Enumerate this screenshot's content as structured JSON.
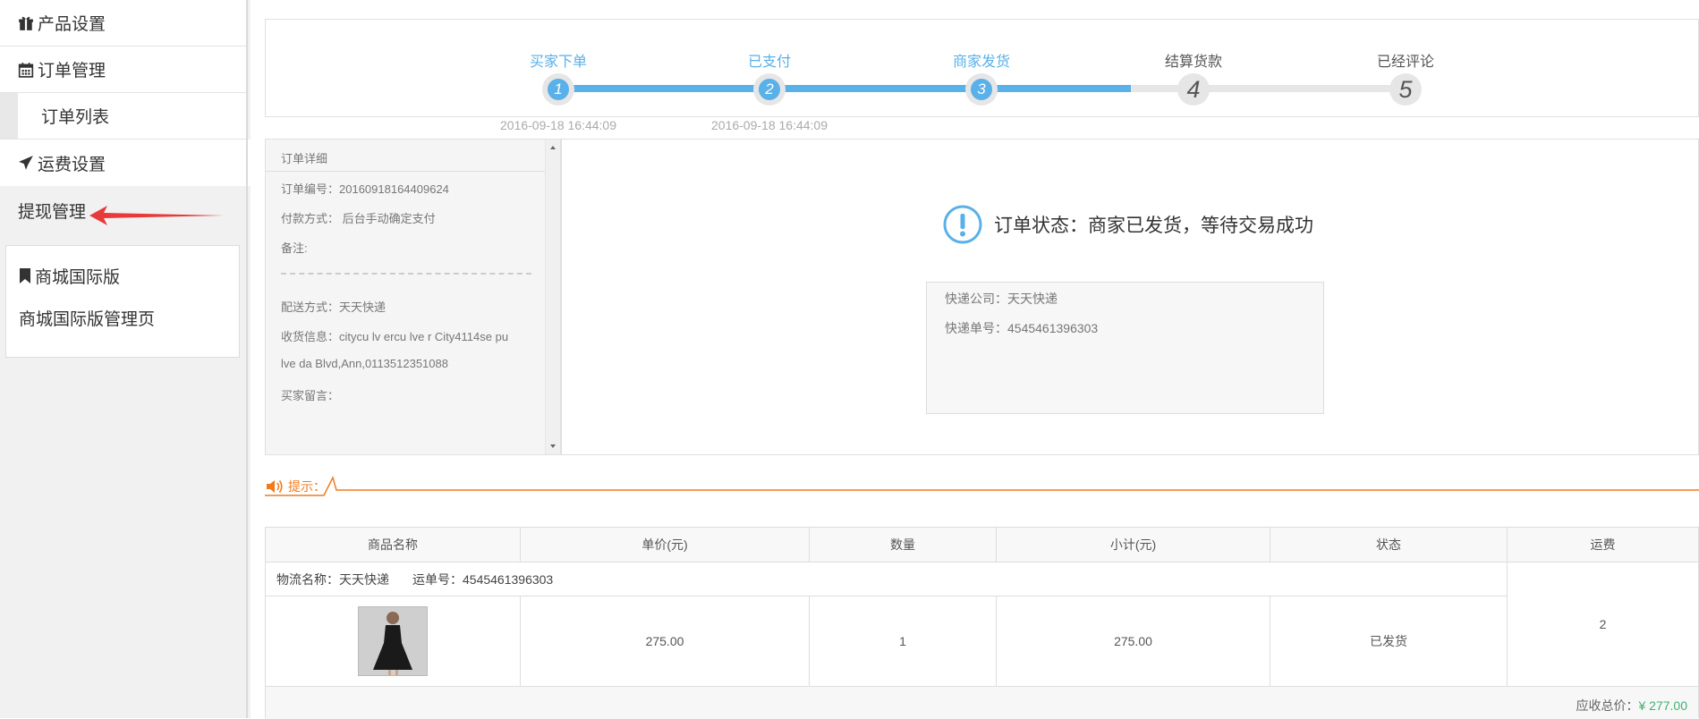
{
  "sidebar": {
    "items": [
      {
        "label": "产品设置",
        "icon": "gift-icon"
      },
      {
        "label": "订单管理",
        "icon": "calendar-icon"
      },
      {
        "label": "订单列表"
      },
      {
        "label": "运费设置",
        "icon": "plane-icon"
      },
      {
        "label": "提现管理"
      }
    ],
    "mall": {
      "title": "商城国际版",
      "icon": "bookmark-icon",
      "link": "商城国际版管理页"
    }
  },
  "progress": {
    "steps": [
      {
        "label": "买家下单",
        "number": "1",
        "time": "2016-09-18 16:44:09",
        "done": true
      },
      {
        "label": "已支付",
        "number": "2",
        "time": "2016-09-18 16:44:09",
        "done": true
      },
      {
        "label": "商家发货",
        "number": "3",
        "time": "",
        "done": true
      },
      {
        "label": "结算货款",
        "number": "4",
        "time": "",
        "done": false
      },
      {
        "label": "已经评论",
        "number": "5",
        "time": "",
        "done": false
      }
    ]
  },
  "detail": {
    "title": "订单详细",
    "order_no": "订单编号：20160918164409624",
    "payment": "付款方式： 后台手动确定支付",
    "remark": "备注:",
    "shipping": "配送方式：天天快递",
    "address_line1": "收货信息：citycu lv ercu lve r City4114se pu",
    "address_line2": "lve da Blvd,Ann,0113512351088",
    "buyer_msg": "买家留言："
  },
  "status": {
    "text": "订单状态：商家已发货，等待交易成功",
    "express_company": "快递公司：天天快递",
    "express_no": "快递单号：4545461396303"
  },
  "tip": {
    "label": "提示："
  },
  "table": {
    "headers": [
      "商品名称",
      "单价(元)",
      "数量",
      "小计(元)",
      "状态",
      "运费"
    ],
    "logistics_name": "物流名称：天天快递",
    "logistics_no": "运单号：4545461396303",
    "row": {
      "price": "275.00",
      "qty": "1",
      "subtotal": "275.00",
      "status": "已发货"
    },
    "fee": "2",
    "total_label": "应收总价：",
    "total_value": "¥ 277.00"
  },
  "colors": {
    "accent": "#5ab0e8",
    "orange": "#f07b1e",
    "green": "#3cb371",
    "arrow": "#e83a3a"
  }
}
